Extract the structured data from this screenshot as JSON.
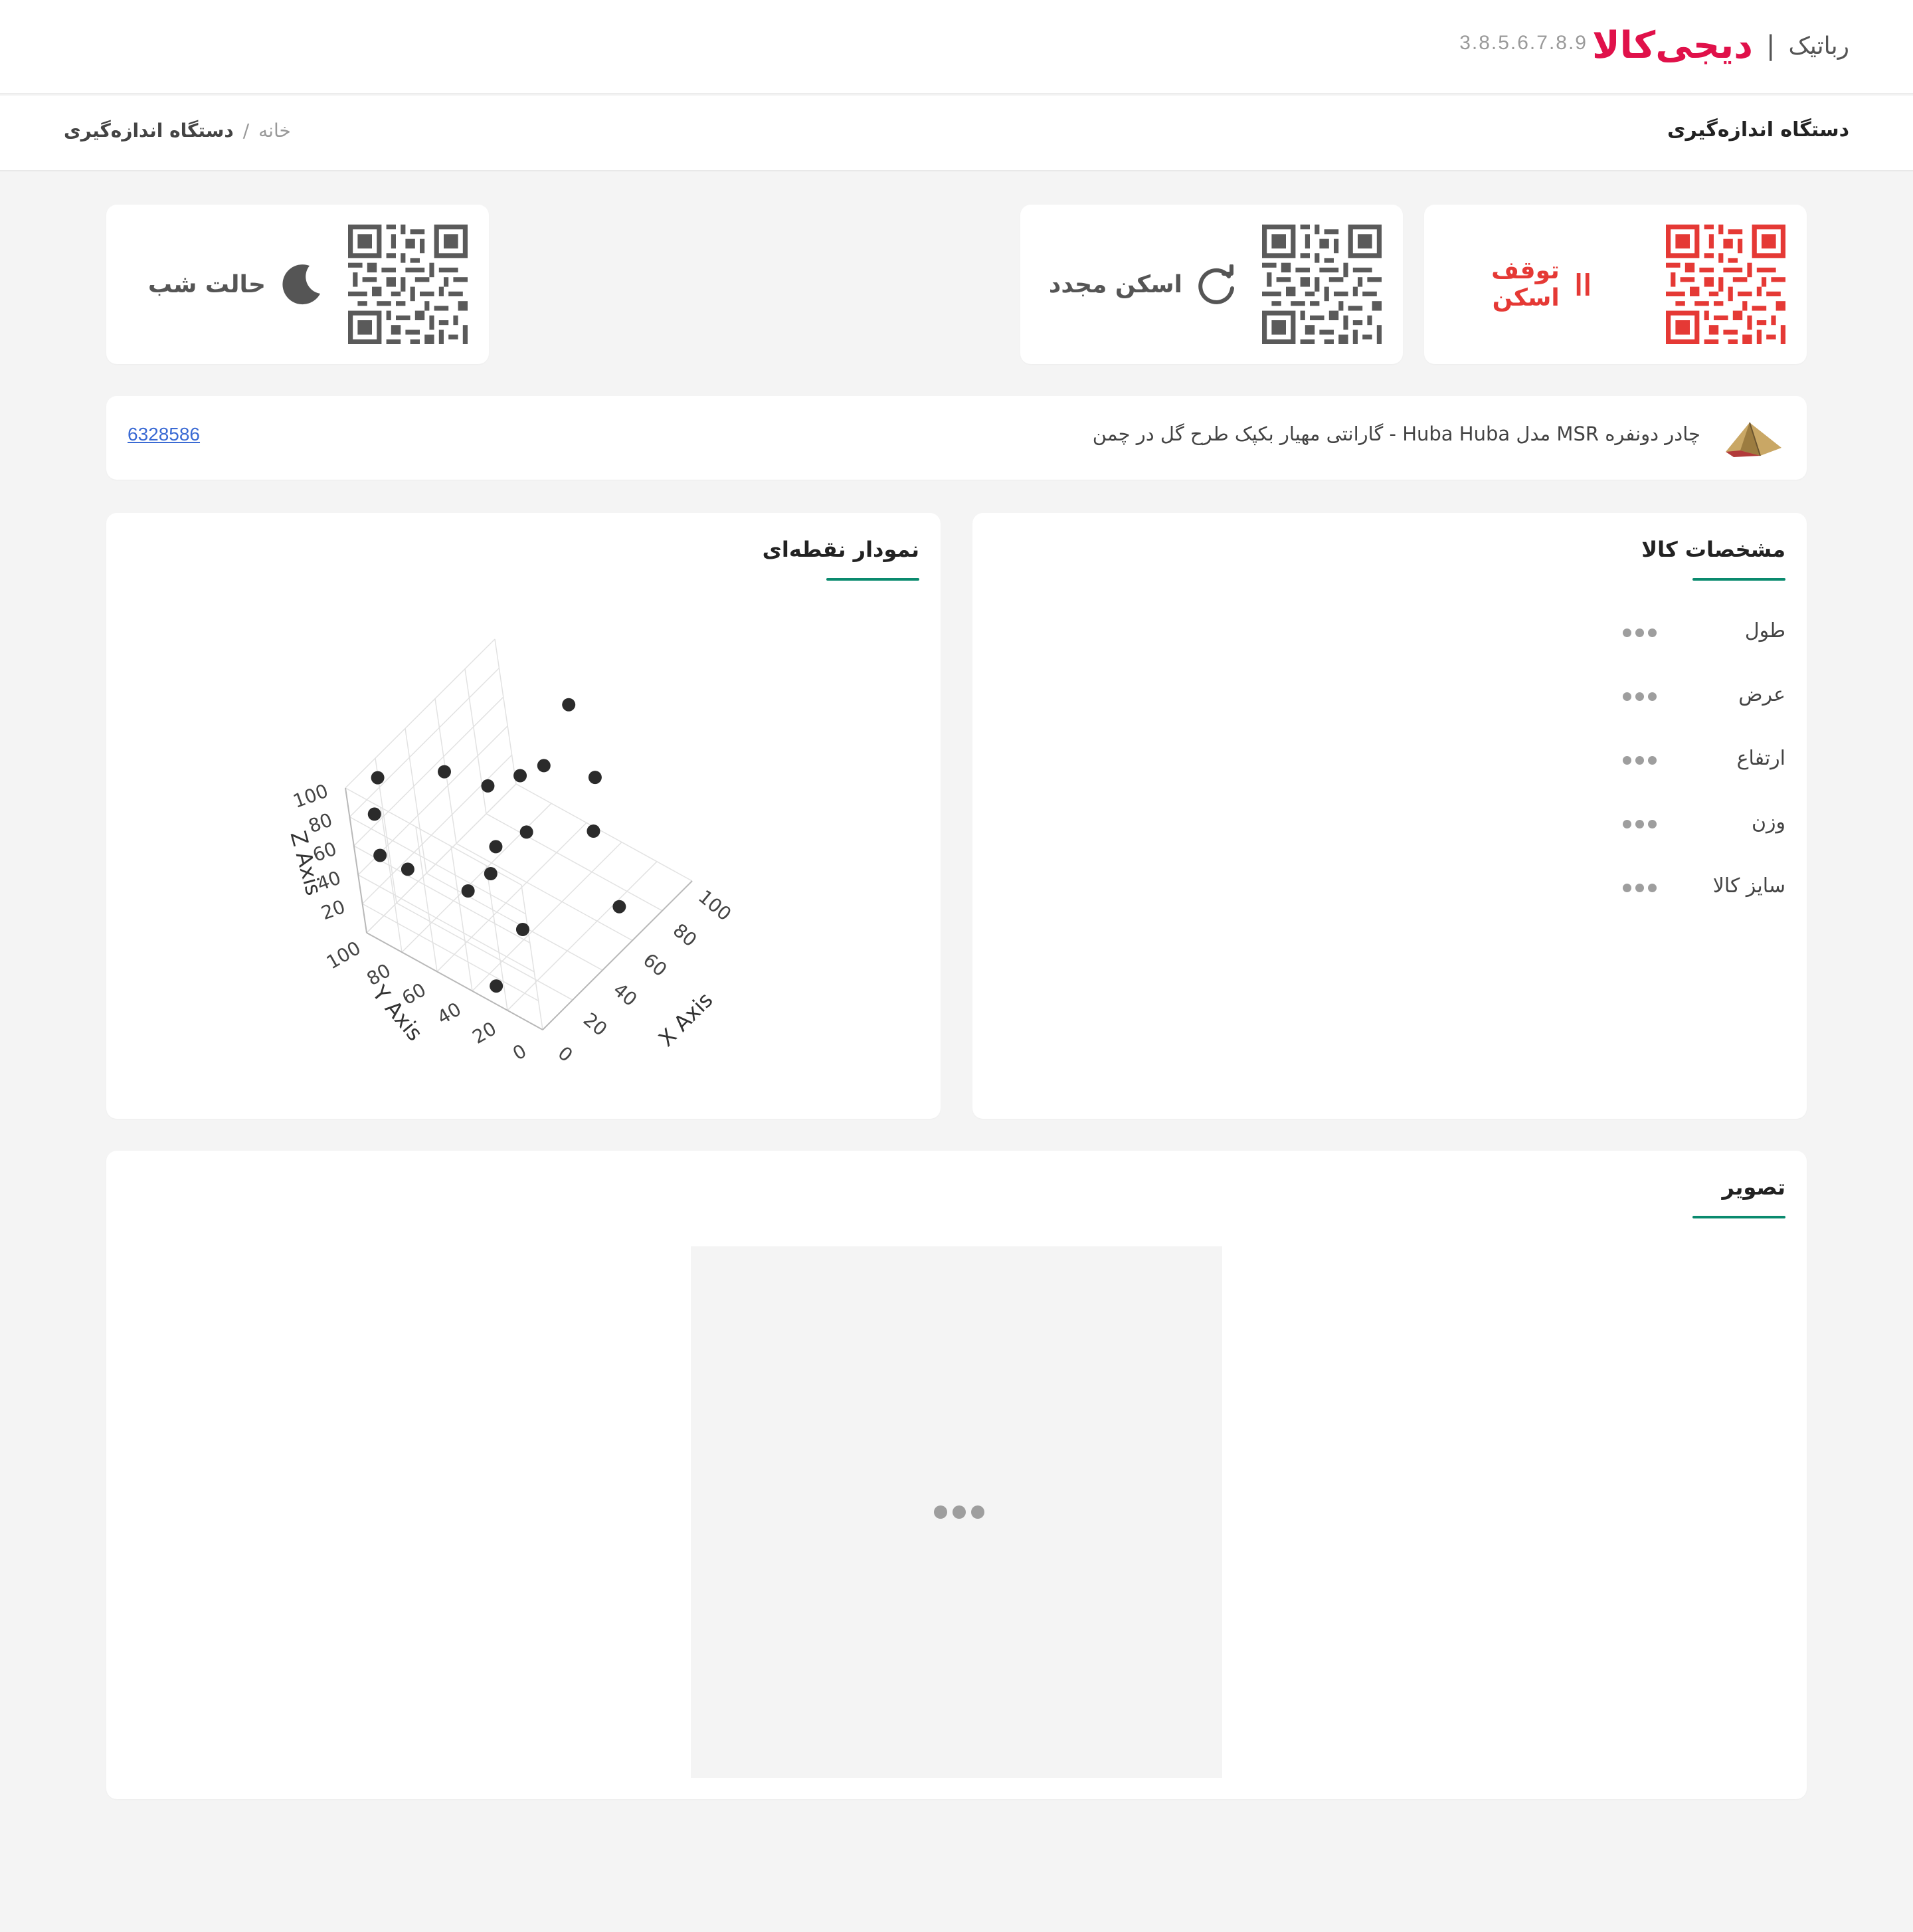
{
  "header": {
    "brand": "دیجی‌کالا",
    "separator": "|",
    "product": "رباتیک",
    "version": "3.8.5.6.7.8.9"
  },
  "subheader": {
    "page_title": "دستگاه اندازه‌گیری",
    "breadcrumb": {
      "home": "خانه",
      "separator": "/",
      "current": "دستگاه اندازه‌گیری"
    }
  },
  "actions": {
    "stop_scan": {
      "label": "توقف اسکن",
      "color": "#e53935",
      "icon": "pause-icon"
    },
    "rescan": {
      "label": "اسکن مجدد",
      "color": "#555555",
      "icon": "refresh-icon"
    },
    "night_mode": {
      "label": "حالت شب",
      "color": "#555555",
      "icon": "moon-icon"
    }
  },
  "product": {
    "name": "چادر دونفره MSR مدل Huba Huba - گارانتی مهیار بکپک طرح گل در چمن",
    "code": "6328586",
    "thumbnail": "tent-thumbnail"
  },
  "specs": {
    "title": "مشخصات کالا",
    "rows": [
      {
        "label": "طول",
        "value": "•••"
      },
      {
        "label": "عرض",
        "value": "•••"
      },
      {
        "label": "ارتفاع",
        "value": "•••"
      },
      {
        "label": "وزن",
        "value": "•••"
      },
      {
        "label": "سایز کالا",
        "value": "•••"
      }
    ]
  },
  "scatter": {
    "title": "نمودار نقطه‌ای"
  },
  "image_section": {
    "title": "تصویر",
    "loading": "•••"
  },
  "colors": {
    "accent_green": "#0a8a6e",
    "brand_red": "#e0114a",
    "stop_red": "#e53935",
    "link_blue": "#3a6ad4"
  },
  "chart_data": {
    "type": "scatter",
    "dimensions": 3,
    "xlabel": "X Axis",
    "ylabel": "Y Axis",
    "zlabel": "Z Axis",
    "xlim": [
      0,
      100
    ],
    "ylim": [
      0,
      100
    ],
    "zlim": [
      0,
      100
    ],
    "xticks": [
      "0",
      "20",
      "40",
      "60",
      "80",
      "100"
    ],
    "yticks": [
      "0",
      "20",
      "40",
      "60",
      "80",
      "100"
    ],
    "zticks": [
      "20",
      "40",
      "60",
      "80",
      "100"
    ],
    "grid": true,
    "points": [
      {
        "x": 5,
        "y": 30,
        "z": 5
      },
      {
        "x": 30,
        "y": 35,
        "z": 15
      },
      {
        "x": 60,
        "y": 5,
        "z": 20
      },
      {
        "x": 25,
        "y": 60,
        "z": 30
      },
      {
        "x": 35,
        "y": 55,
        "z": 35
      },
      {
        "x": 45,
        "y": 60,
        "z": 40
      },
      {
        "x": 20,
        "y": 90,
        "z": 30
      },
      {
        "x": 50,
        "y": 45,
        "z": 55
      },
      {
        "x": 75,
        "y": 30,
        "z": 40
      },
      {
        "x": 55,
        "y": 70,
        "z": 65
      },
      {
        "x": 45,
        "y": 85,
        "z": 75
      },
      {
        "x": 70,
        "y": 65,
        "z": 60
      },
      {
        "x": 90,
        "y": 40,
        "z": 55
      },
      {
        "x": 10,
        "y": 95,
        "z": 75
      },
      {
        "x": 15,
        "y": 95,
        "z": 95
      },
      {
        "x": 80,
        "y": 60,
        "z": 60
      },
      {
        "x": 95,
        "y": 55,
        "z": 90
      },
      {
        "x": 5,
        "y": 90,
        "z": 55
      }
    ]
  }
}
